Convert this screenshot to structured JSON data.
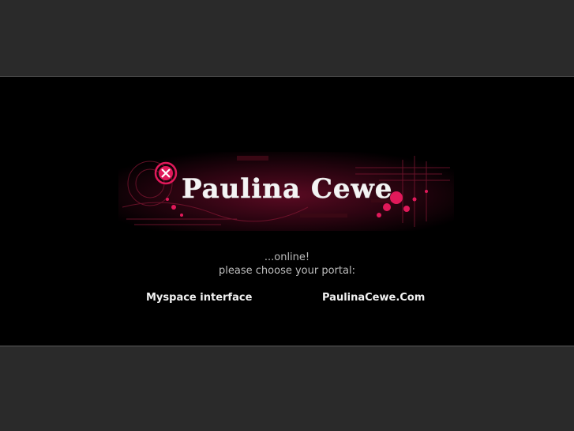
{
  "banner": {
    "logo_text": "Paulina Cewe",
    "colors": {
      "accent": "#e0195a",
      "background": "#000000",
      "page_bg": "#2a2a2a"
    }
  },
  "tagline": {
    "line1": "...online!",
    "line2": "please choose your portal:"
  },
  "portals": {
    "myspace_label": "Myspace interface",
    "site_label": "PaulinaCewe.Com"
  }
}
